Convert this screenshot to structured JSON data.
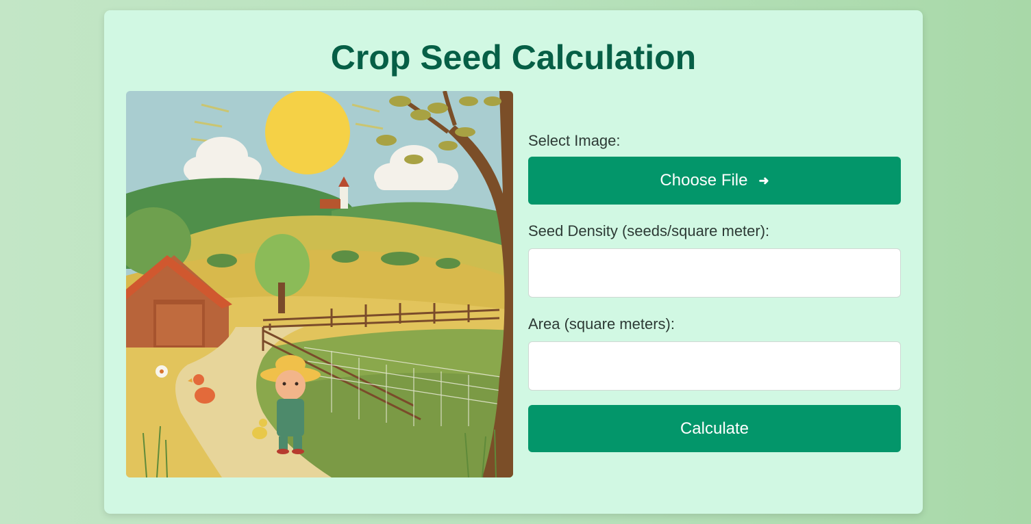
{
  "page": {
    "title": "Crop Seed Calculation"
  },
  "illustration": {
    "icon": "farm-illustration"
  },
  "form": {
    "image_label": "Select Image:",
    "choose_file_label": "Choose File",
    "choose_file_icon": "arrow-right-icon",
    "seed_density_label": "Seed Density (seeds/square meter):",
    "seed_density_value": "",
    "area_label": "Area (square meters):",
    "area_value": "",
    "calculate_label": "Calculate"
  },
  "colors": {
    "page_bg": "#b8e2bd",
    "card_bg": "#d1f8e3",
    "title": "#065f46",
    "button": "#03966a",
    "button_text": "#ffffff"
  }
}
